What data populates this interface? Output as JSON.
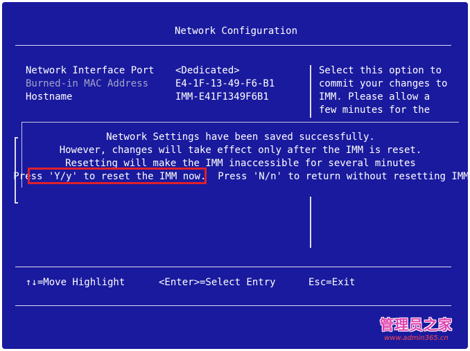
{
  "title": "Network Configuration",
  "settings": [
    {
      "label": "Network Interface Port",
      "value": "<Dedicated>"
    },
    {
      "label": "Burned-in MAC Address",
      "value": "E4-1F-13-49-F6-B1"
    },
    {
      "label": "Hostname",
      "value": "IMM-E41F1349F6B1"
    }
  ],
  "help_text": [
    "Select this option to",
    "commit your changes to",
    "IMM. Please allow a",
    "few minutes for the"
  ],
  "dialog": {
    "line1": "Network Settings have been saved successfully.",
    "line2": "However, changes will take effect only after the IMM is reset.",
    "line3": "Resetting will make the IMM inaccessible for several minutes",
    "line4": "Press 'Y/y' to reset the IMM now.  Press 'N/n' to return without resetting IMM"
  },
  "footer": {
    "move": "↑↓=Move Highlight",
    "select": "<Enter>=Select Entry",
    "exit": "Esc=Exit"
  },
  "watermark": {
    "main": "管理员之家",
    "sub": "www.admin365.cn"
  },
  "colors": {
    "background": "#1a1a9e",
    "text": "#ffffff",
    "dim_text": "#a3a3cc",
    "highlight_box": "#e0202a"
  }
}
